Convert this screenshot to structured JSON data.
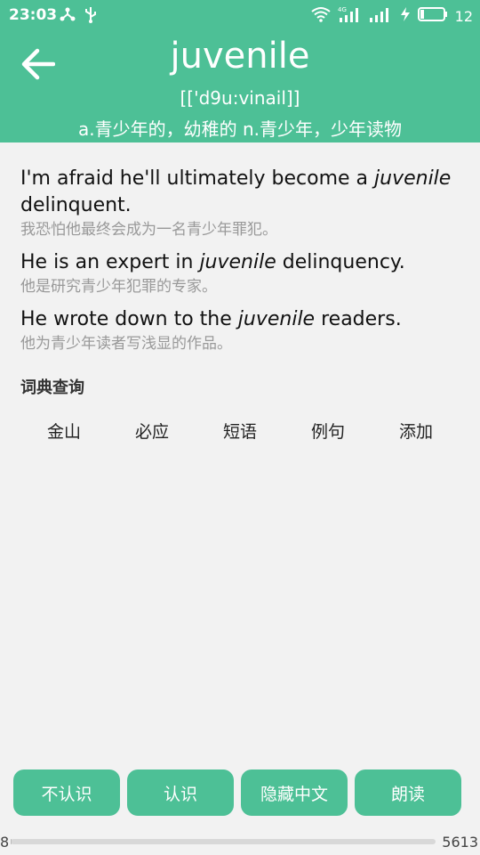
{
  "status_bar": {
    "time": "23:03",
    "battery_level": "12",
    "icons": [
      "share-icon",
      "usb-icon",
      "wifi-icon",
      "signal-4g-icon",
      "signal-icon",
      "charging-icon",
      "battery-icon"
    ]
  },
  "header": {
    "word": "juvenile",
    "phonetic": "[['d9u:vinail]]",
    "definition": "a.青少年的，幼稚的 n.青少年，少年读物",
    "colors": {
      "accent": "#4dc096"
    }
  },
  "examples": [
    {
      "en_before": "I'm afraid he'll ultimately become a ",
      "en_highlight": "juvenile",
      "en_after": " delinquent.",
      "zh": "我恐怕他最终会成为一名青少年罪犯。"
    },
    {
      "en_before": "He is an expert in ",
      "en_highlight": "juvenile",
      "en_after": " delinquency.",
      "zh": "他是研究青少年犯罪的专家。"
    },
    {
      "en_before": "He wrote down to the ",
      "en_highlight": "juvenile",
      "en_after": " readers.",
      "zh": "他为青少年读者写浅显的作品。"
    }
  ],
  "dictionary": {
    "title": "词典查询",
    "tabs": [
      "金山",
      "必应",
      "短语",
      "例句",
      "添加"
    ]
  },
  "actions": {
    "unknown": "不认识",
    "known": "认识",
    "hide_chinese": "隐藏中文",
    "read_aloud": "朗读"
  },
  "progress": {
    "start": "8",
    "end": "5613",
    "fraction": 0.0014
  }
}
